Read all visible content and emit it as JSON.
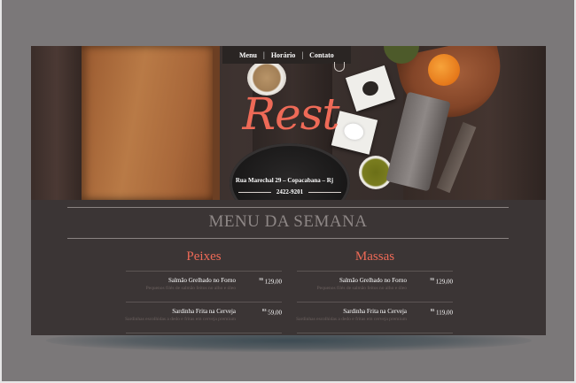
{
  "nav": {
    "items": [
      "Menu",
      "Horário",
      "Contato"
    ],
    "separator": "|"
  },
  "hero": {
    "logo": "Rest",
    "address": "Rua Marechal 29 – Copacabana – Rj",
    "phone": "2422-9201"
  },
  "menu": {
    "title": "MENU DA SEMANA",
    "columns": [
      {
        "title": "Peixes",
        "items": [
          {
            "name": "Salmão Grelhado no Forno",
            "desc": "Pequenos filés de salmão feitos no alho e óleo",
            "currency": "R$",
            "price": "129,00"
          },
          {
            "name": "Sardinha Frita na Cerveja",
            "desc": "Sardinhas escolhidas a dedo e fritas em cerveja premium",
            "currency": "R$",
            "price": "59,00"
          }
        ]
      },
      {
        "title": "Massas",
        "items": [
          {
            "name": "Salmão Grelhado no Forno",
            "desc": "Pequenos filés de salmão feitos no alho e óleo",
            "currency": "R$",
            "price": "129,00"
          },
          {
            "name": "Sardinha Frita na Cerveja",
            "desc": "Sardinhas escolhidas a dedo e fritas em cerveja premium",
            "currency": "R$",
            "price": "119,00"
          }
        ]
      }
    ]
  },
  "colors": {
    "accent": "#ee6a57",
    "panel": "#3b3535",
    "background": "#7b7879"
  }
}
